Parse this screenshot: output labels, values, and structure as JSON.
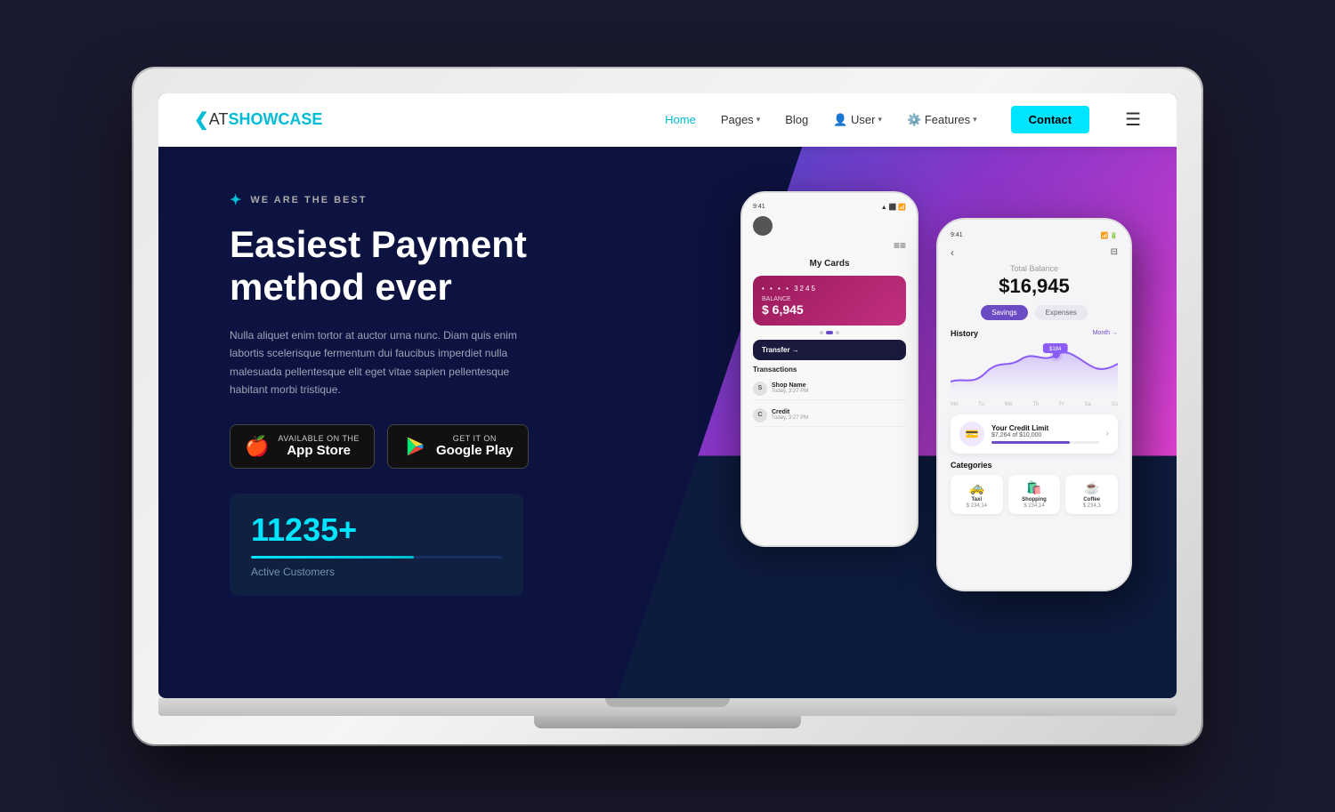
{
  "laptop": {
    "screen": {
      "navbar": {
        "logo_bracket": "❮",
        "logo_at": "AT",
        "logo_showcase": "SHOWCASE",
        "links": [
          {
            "label": "Home",
            "active": true,
            "hasDropdown": false
          },
          {
            "label": "Pages",
            "active": false,
            "hasDropdown": true
          },
          {
            "label": "Blog",
            "active": false,
            "hasDropdown": false
          },
          {
            "label": "User",
            "active": false,
            "hasDropdown": true
          },
          {
            "label": "Features",
            "active": false,
            "hasDropdown": true
          }
        ],
        "contact_label": "Contact"
      },
      "hero": {
        "badge_icon": "✦",
        "badge_text": "WE ARE THE BEST",
        "title_line1": "Easiest Payment",
        "title_line2": "method ever",
        "description": "Nulla aliquet enim tortor at auctor urna nunc. Diam quis enim labortis scelerisque fermentum dui faucibus imperdiet nulla malesuada pellentesque elit eget vitae sapien pellentesque habitant morbi tristique.",
        "app_store": {
          "sub": "Available on the",
          "main": "App Store"
        },
        "google_play": {
          "sub": "GET IT ON",
          "main": "Google Play"
        },
        "stats": {
          "number": "11235+",
          "label": "Active Customers",
          "progress_pct": 65
        }
      },
      "phone_back": {
        "time": "9:41",
        "title": "My Cards",
        "card_dots": "• • • •  3245",
        "balance_label": "Balance",
        "balance": "$ 6,945",
        "transfer_label": "Transfer →",
        "transactions_title": "Transactions",
        "transactions": [
          {
            "initial": "S",
            "name": "Shop Name",
            "date": "Today, 3:27 PM"
          },
          {
            "initial": "C",
            "name": "Credit",
            "date": "Today, 3:27 PM"
          }
        ]
      },
      "phone_front": {
        "time": "9:41",
        "total_label": "Total Balance",
        "total_amount": "$16,945",
        "tab_savings": "Savings",
        "tab_expenses": "Expenses",
        "history_label": "History",
        "history_link": "Month →",
        "chart_labels": [
          "Mo",
          "Tu",
          "We",
          "Th",
          "Fr",
          "Sa",
          "Su"
        ],
        "credit_text": "Your Credit Limit",
        "credit_amount": "$7,264 of $10,000",
        "categories_title": "Categories",
        "categories": [
          {
            "icon": "🚕",
            "label": "Taxi",
            "amount": "$ 234,14"
          },
          {
            "icon": "🛍️",
            "label": "Shopping",
            "amount": "$ 234,14"
          },
          {
            "icon": "☕",
            "label": "Coffee",
            "amount": "$ 234,3"
          }
        ]
      }
    }
  }
}
